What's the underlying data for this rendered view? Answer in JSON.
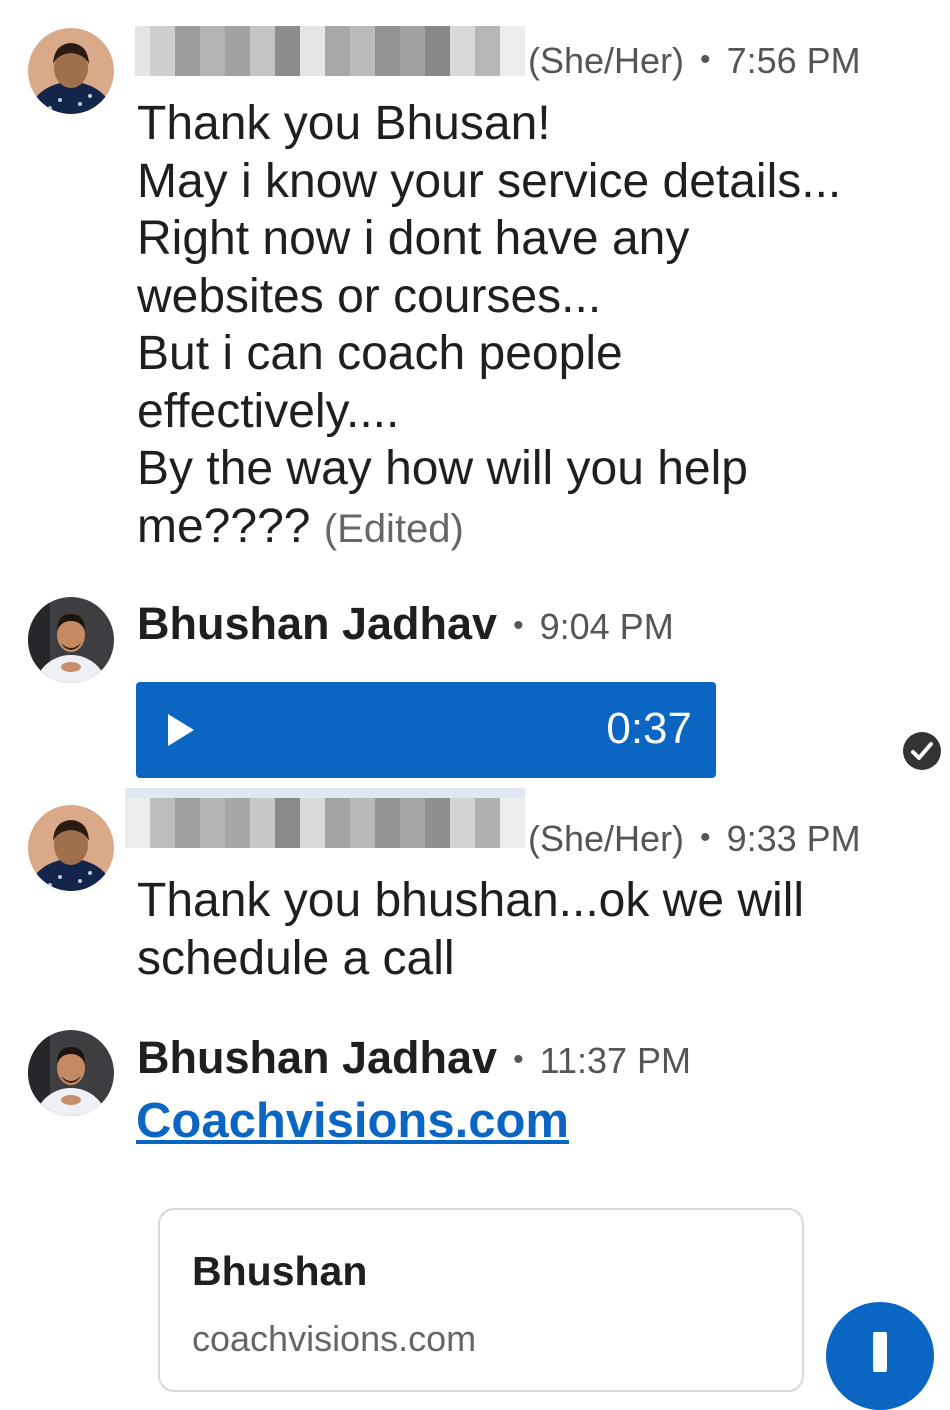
{
  "messages": [
    {
      "sender_pronouns": "(She/Her)",
      "time": "7:56 PM",
      "lines": [
        "Thank you Bhusan!",
        "May i know your service details...",
        "Right now i dont have any",
        "websites or courses...",
        "But i can coach people",
        "effectively....",
        "By the way how will you help",
        "me????"
      ],
      "edited_label": "(Edited)"
    },
    {
      "sender_name": "Bhushan Jadhav",
      "time": "9:04 PM",
      "audio_duration": "0:37"
    },
    {
      "sender_pronouns": "(She/Her)",
      "time": "9:33 PM",
      "lines": [
        "Thank you bhushan...ok we will",
        "schedule a call"
      ]
    },
    {
      "sender_name": "Bhushan Jadhav",
      "time": "11:37 PM",
      "link_text": "Coachvisions.com",
      "card": {
        "title": "Bhushan",
        "domain": "coachvisions.com"
      }
    }
  ],
  "icons": {
    "play": "play-icon",
    "seen": "checkmark-circle-icon",
    "compose": "plus-icon"
  },
  "colors": {
    "accent": "#0a66c2",
    "text": "#1f1f1f",
    "meta": "#555555"
  }
}
